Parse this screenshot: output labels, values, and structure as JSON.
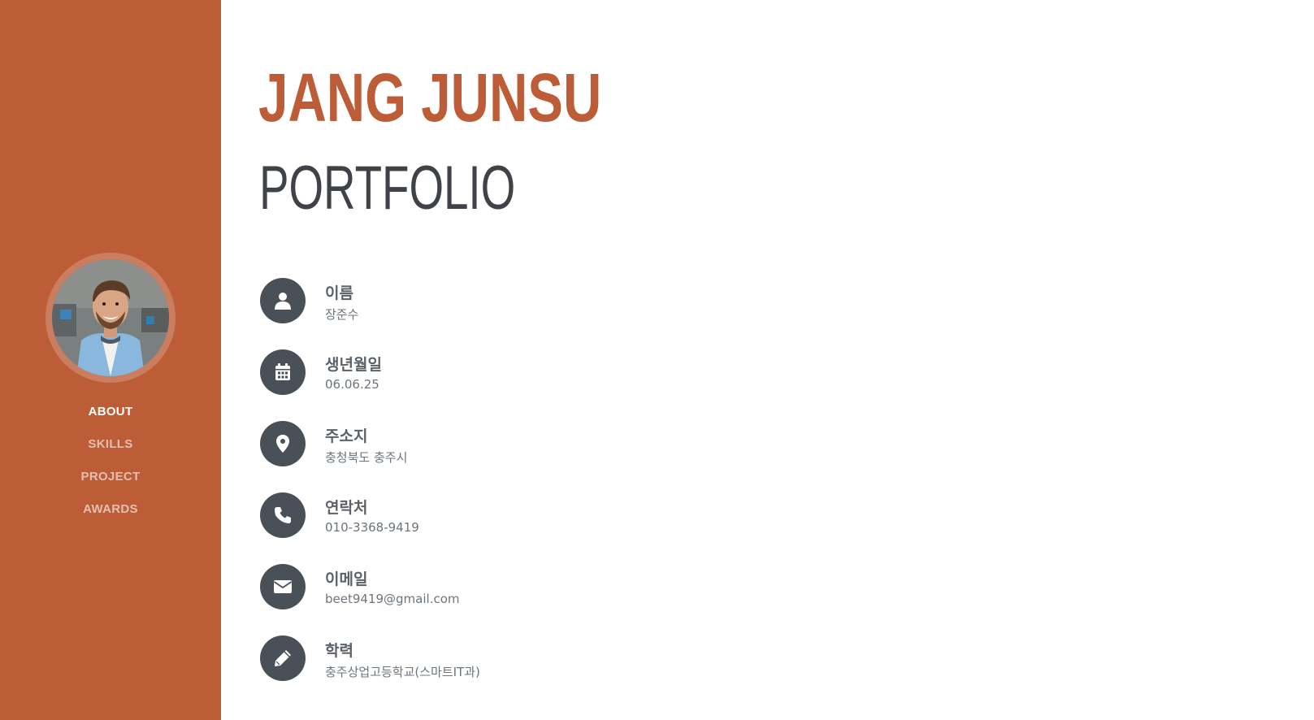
{
  "sidebar": {
    "nav": [
      {
        "label": "ABOUT",
        "active": true
      },
      {
        "label": "SKILLS",
        "active": false
      },
      {
        "label": "PROJECT",
        "active": false
      },
      {
        "label": "AWARDS",
        "active": false
      }
    ]
  },
  "header": {
    "name": "JANG JUNSU",
    "subtitle": "PORTFOLIO"
  },
  "info": [
    {
      "icon": "user-icon",
      "label": "이름",
      "value": "장준수"
    },
    {
      "icon": "calendar-icon",
      "label": "생년월일",
      "value": "06.06.25"
    },
    {
      "icon": "map-marker-icon",
      "label": "주소지",
      "value": "충청북도 충주시"
    },
    {
      "icon": "phone-icon",
      "label": "연락처",
      "value": "010-3368-9419"
    },
    {
      "icon": "envelope-icon",
      "label": "이메일",
      "value": "beet9419@gmail.com"
    },
    {
      "icon": "pencil-icon",
      "label": "학력",
      "value": "충주상업고등학교(스마트IT과)"
    }
  ],
  "colors": {
    "accent": "#bd5d38",
    "icon_bg": "#495057",
    "heading_dark": "#3f4347"
  }
}
